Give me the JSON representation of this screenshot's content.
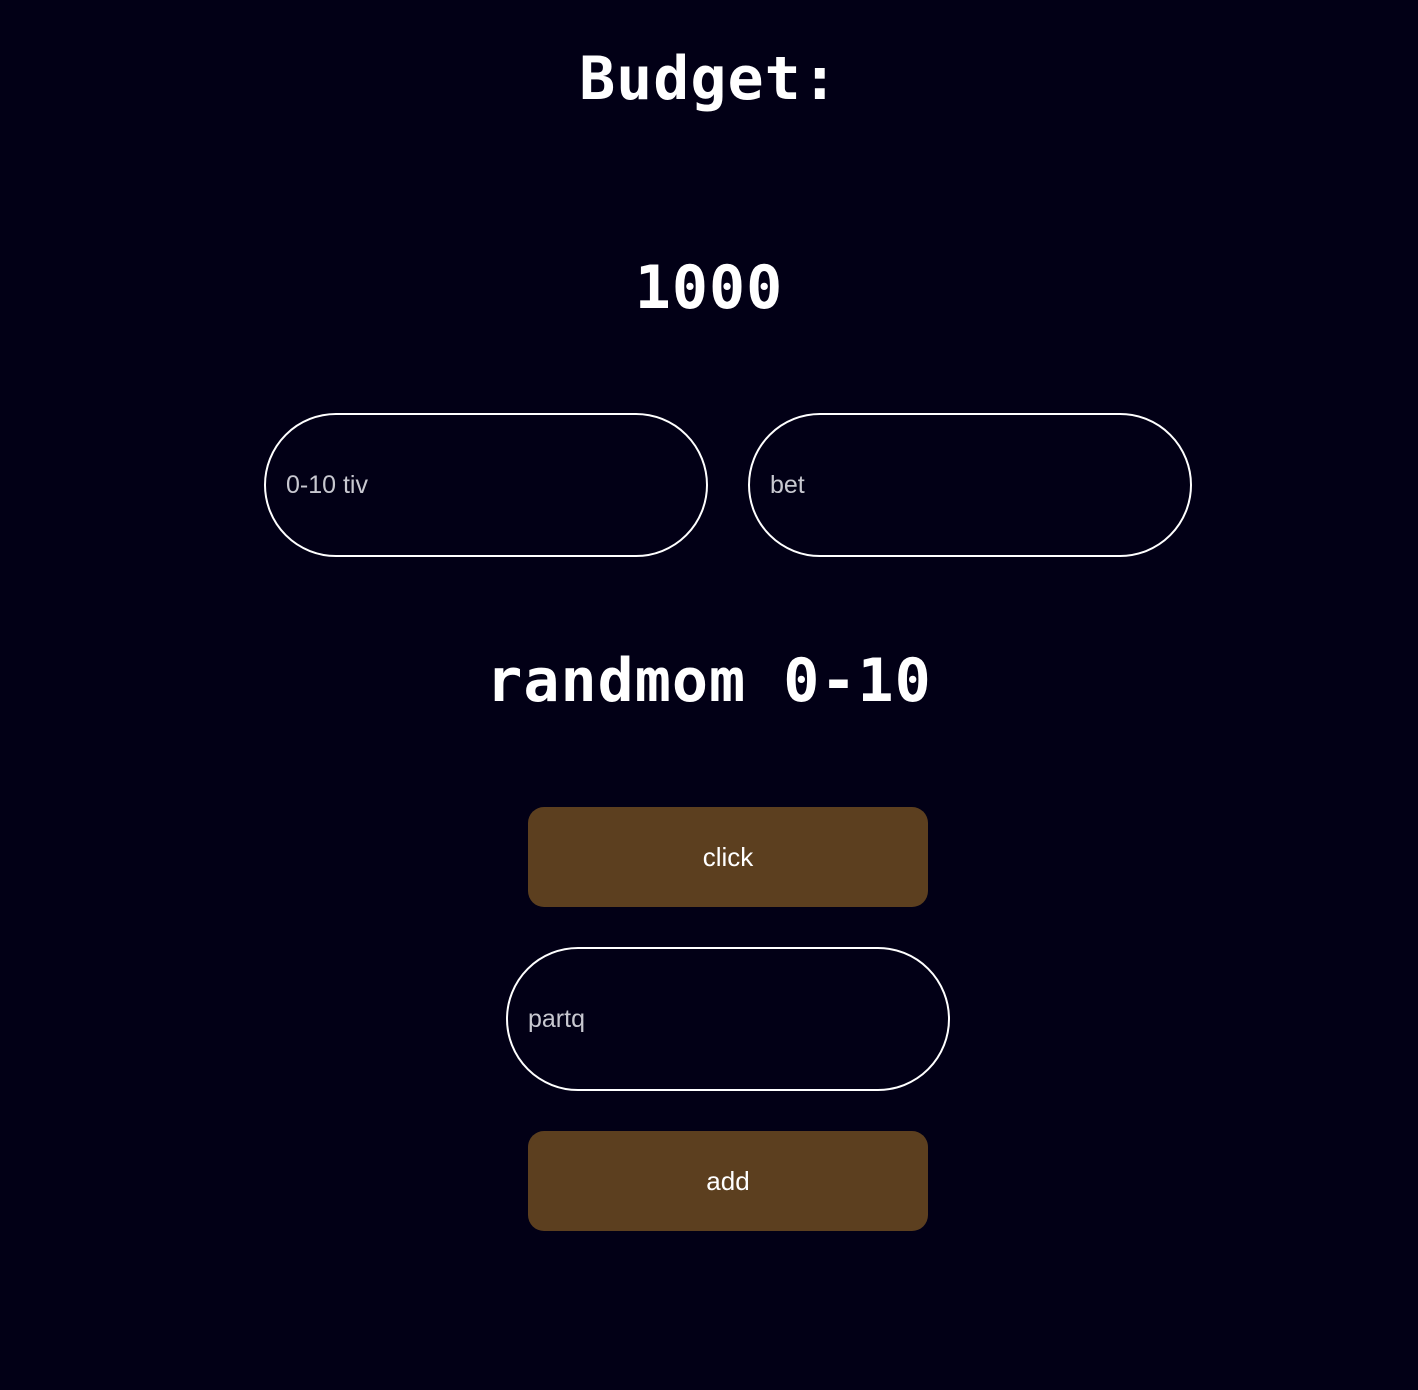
{
  "header": {
    "title": "Budget:",
    "budget_value": "1000"
  },
  "inputs": {
    "guess": {
      "placeholder": "0-10 tiv",
      "value": ""
    },
    "bet": {
      "placeholder": "bet",
      "value": ""
    },
    "partq": {
      "placeholder": "partq",
      "value": ""
    }
  },
  "random_label": "randmom 0-10",
  "buttons": {
    "click_label": "click",
    "add_label": "add"
  },
  "colors": {
    "background": "#020016",
    "text": "#ffffff",
    "button": "#5c3f1f",
    "input_border": "#ffffff"
  }
}
